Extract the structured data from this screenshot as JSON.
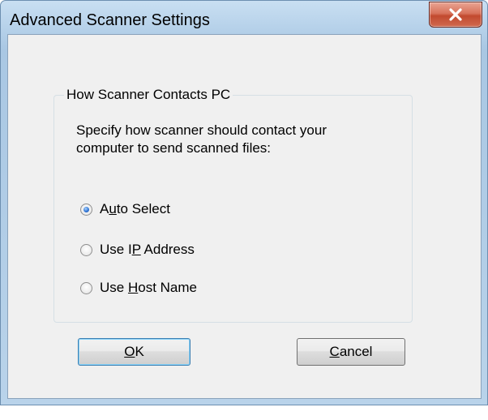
{
  "window": {
    "title": "Advanced Scanner Settings",
    "close_label": "Close"
  },
  "group": {
    "legend": "How Scanner Contacts PC",
    "description_line1": "Specify how scanner should contact your",
    "description_line2": "computer to send scanned files:"
  },
  "options": [
    {
      "pre": "A",
      "mnemonic": "u",
      "post": "to Select",
      "checked": true
    },
    {
      "pre": "Use I",
      "mnemonic": "P",
      "post": " Address",
      "checked": false
    },
    {
      "pre": "Use ",
      "mnemonic": "H",
      "post": "ost Name",
      "checked": false
    }
  ],
  "buttons": {
    "ok": {
      "mnemonic": "O",
      "post": "K"
    },
    "cancel": {
      "mnemonic": "C",
      "post": "ancel"
    }
  },
  "colors": {
    "frame": "#b7d2ea",
    "client": "#f0f0f0",
    "close_button": "#c24a2f"
  }
}
